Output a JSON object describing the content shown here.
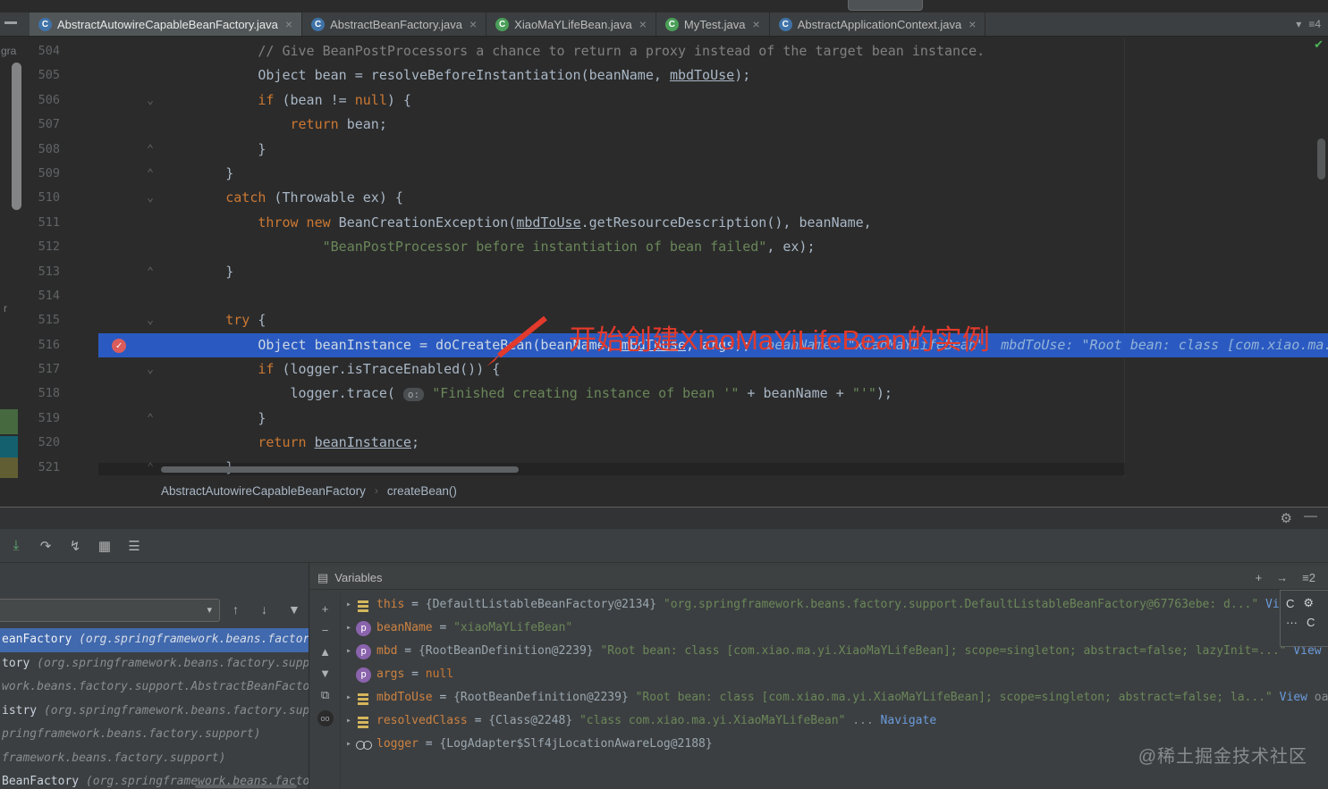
{
  "icons": {
    "tab_close": "×",
    "tabs_dropdown": "▾",
    "tabs_menu": "≡4",
    "inspection_check": "✔",
    "gear": "⚙",
    "minimize": "—",
    "exec_point": "⤓",
    "force_step_over": "↷",
    "force_step_into": "↯",
    "view_breakpoints": "▦",
    "settings_lines": "☰",
    "variables_panel": "▤",
    "add_watch": "+",
    "remove_watch": "−",
    "move_up": "▲",
    "move_down": "▼",
    "duplicate": "⧉",
    "watch_toggle": "oo",
    "header_add": "+",
    "header_jump": "→",
    "header_layout": "≡2",
    "combo_arrow": "▾",
    "frame_up": "↑",
    "frame_down": "↓",
    "frame_filter": "▼",
    "expand_arrow": "▸",
    "fold_open": "⌄",
    "fold_close": "⌃",
    "breakpoint_check": "✓",
    "breadcrumb_sep": "›",
    "console_tab": "C",
    "overlay_more": "···"
  },
  "tabs": {
    "items": [
      {
        "label": "AbstractAutowireCapableBeanFactory.java",
        "kind": "class",
        "active": true
      },
      {
        "label": "AbstractBeanFactory.java",
        "kind": "class",
        "active": false
      },
      {
        "label": "XiaoMaYLifeBean.java",
        "kind": "class-green",
        "active": false
      },
      {
        "label": "MyTest.java",
        "kind": "class-green",
        "active": false
      },
      {
        "label": "AbstractApplicationContext.java",
        "kind": "class",
        "active": false
      }
    ]
  },
  "left_stripe": {
    "labels": [
      "gra",
      "r"
    ]
  },
  "editor": {
    "exec_line": 516,
    "breakpoint_line": 516,
    "fold_markers": {
      "506": "open",
      "508": "close",
      "509": "close",
      "510": "open",
      "513": "close",
      "515": "open",
      "517": "open",
      "519": "close",
      "521": "close"
    },
    "annotation_text": "开始创建XiaoMaYiLifeBean的实例",
    "lines": [
      {
        "num": 504,
        "ind": 12,
        "segs": [
          [
            "cmt",
            "// Give BeanPostProcessors a chance to return a proxy instead of the target bean instance."
          ]
        ]
      },
      {
        "num": 505,
        "ind": 12,
        "segs": [
          [
            "pl",
            "Object bean = resolveBeforeInstantiation(beanName, "
          ],
          [
            "und",
            "mbdToUse"
          ],
          [
            "pl",
            ");"
          ]
        ]
      },
      {
        "num": 506,
        "ind": 12,
        "segs": [
          [
            "kw",
            "if "
          ],
          [
            "pl",
            "(bean != "
          ],
          [
            "kw",
            "null"
          ],
          [
            "pl",
            ") {"
          ]
        ]
      },
      {
        "num": 507,
        "ind": 16,
        "segs": [
          [
            "kw",
            "return "
          ],
          [
            "pl",
            "bean;"
          ]
        ]
      },
      {
        "num": 508,
        "ind": 12,
        "segs": [
          [
            "pl",
            "}"
          ]
        ]
      },
      {
        "num": 509,
        "ind": 8,
        "segs": [
          [
            "pl",
            "}"
          ]
        ]
      },
      {
        "num": 510,
        "ind": 8,
        "segs": [
          [
            "kw",
            "catch "
          ],
          [
            "pl",
            "(Throwable ex) {"
          ]
        ]
      },
      {
        "num": 511,
        "ind": 12,
        "segs": [
          [
            "kw",
            "throw new "
          ],
          [
            "pl",
            "BeanCreationException("
          ],
          [
            "und",
            "mbdToUse"
          ],
          [
            "pl",
            ".getResourceDescription(), beanName,"
          ]
        ]
      },
      {
        "num": 512,
        "ind": 20,
        "segs": [
          [
            "str",
            "\"BeanPostProcessor before instantiation of bean failed\""
          ],
          [
            "pl",
            ", ex);"
          ]
        ]
      },
      {
        "num": 513,
        "ind": 8,
        "segs": [
          [
            "pl",
            "}"
          ]
        ]
      },
      {
        "num": 514,
        "ind": 0,
        "segs": []
      },
      {
        "num": 515,
        "ind": 8,
        "segs": [
          [
            "kw",
            "try "
          ],
          [
            "pl",
            "{"
          ]
        ]
      },
      {
        "num": 516,
        "ind": 12,
        "segs": [
          [
            "pl",
            "Object beanInstance = doCreateBean(beanName, "
          ],
          [
            "und",
            "mbdToUse"
          ],
          [
            "pl",
            ", args);"
          ],
          [
            "hint",
            "  beanName: \"xiaoMaYLifeBean\"  mbdToUse: \"Root bean: class [com.xiao.ma."
          ]
        ]
      },
      {
        "num": 517,
        "ind": 12,
        "segs": [
          [
            "kw",
            "if "
          ],
          [
            "pl",
            "(logger.isTraceEnabled()) {"
          ]
        ]
      },
      {
        "num": 518,
        "ind": 16,
        "segs": [
          [
            "pl",
            "logger.trace( "
          ],
          [
            "ph",
            "o:"
          ],
          [
            "pl",
            " "
          ],
          [
            "str",
            "\"Finished creating instance of bean '\""
          ],
          [
            "pl",
            " + beanName + "
          ],
          [
            "str",
            "\"'\""
          ],
          [
            "pl",
            ");"
          ]
        ]
      },
      {
        "num": 519,
        "ind": 12,
        "segs": [
          [
            "pl",
            "}"
          ]
        ]
      },
      {
        "num": 520,
        "ind": 12,
        "segs": [
          [
            "kw",
            "return "
          ],
          [
            "und",
            "beanInstance"
          ],
          [
            "pl",
            ";"
          ]
        ]
      },
      {
        "num": 521,
        "ind": 8,
        "segs": [
          [
            "pl",
            "}"
          ]
        ]
      }
    ]
  },
  "breadcrumb": {
    "items": [
      "AbstractAutowireCapableBeanFactory",
      "createBean()"
    ]
  },
  "debug": {
    "variables_title": "Variables",
    "toolbar": [
      "exec_point",
      "force_step_over",
      "force_step_into",
      "view_breakpoints",
      "settings_lines"
    ],
    "vars_toolbar": [
      "add_watch",
      "remove_watch",
      "move_up",
      "move_down",
      "duplicate",
      "watch_toggle"
    ],
    "header_icons": [
      "header_add",
      "header_jump",
      "header_layout"
    ],
    "frames": [
      {
        "name": "eanFactory ",
        "pkg": "(org.springframework.beans.factory.",
        "selected": true
      },
      {
        "name": "tory ",
        "pkg": "(org.springframework.beans.factory.suppo",
        "selected": false
      },
      {
        "name": "",
        "pkg": "work.beans.factory.support.AbstractBeanFactor",
        "selected": false
      },
      {
        "name": "istry ",
        "pkg": "(org.springframework.beans.factory.supp",
        "selected": false
      },
      {
        "name": "",
        "pkg": "pringframework.beans.factory.support)",
        "selected": false
      },
      {
        "name": "",
        "pkg": "framework.beans.factory.support)",
        "selected": false
      },
      {
        "name": "BeanFactory ",
        "pkg": "(org.springframework.beans.facto.",
        "selected": false
      }
    ],
    "variables": [
      {
        "icon": "bars",
        "expand": true,
        "name": "this",
        "value_ref": "{DefaultListableBeanFactory@2134} ",
        "value_str": "\"org.springframework.beans.factory.support.DefaultListableBeanFactory@67763ebe: d...\"",
        "link": "View"
      },
      {
        "icon": "p",
        "expand": true,
        "name": "beanName",
        "value_str": "\"xiaoMaYLifeBean\""
      },
      {
        "icon": "p",
        "expand": true,
        "name": "mbd",
        "value_ref": "{RootBeanDefinition@2239} ",
        "value_str": "\"Root bean: class [com.xiao.ma.yi.XiaoMaYLifeBean]; scope=singleton; abstract=false; lazyInit=...\"",
        "link": "View"
      },
      {
        "icon": "p",
        "expand": false,
        "name": "args",
        "value_kw": "null"
      },
      {
        "icon": "bars",
        "expand": true,
        "name": "mbdToUse",
        "value_ref": "{RootBeanDefinition@2239} ",
        "value_str": "\"Root bean: class [com.xiao.ma.yi.XiaoMaYLifeBean]; scope=singleton; abstract=false; la...\"",
        "link": "View",
        "tail": "oaded."
      },
      {
        "icon": "bars",
        "expand": true,
        "name": "resolvedClass",
        "value_ref": "{Class@2248} ",
        "value_str": "\"class com.xiao.ma.yi.XiaoMaYLifeBean\"",
        "dots": "...",
        "link": "Navigate"
      },
      {
        "icon": "oo",
        "expand": true,
        "name": "logger",
        "value_ref": "{LogAdapter$Slf4jLocationAwareLog@2188}"
      }
    ]
  },
  "watermark": "@稀土掘金技术社区"
}
